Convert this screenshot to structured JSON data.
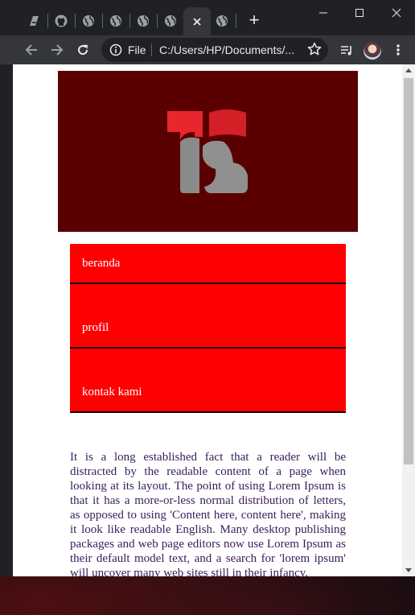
{
  "browser": {
    "tabs": [
      {
        "icon": "app-icon"
      },
      {
        "icon": "github-icon"
      },
      {
        "icon": "globe-icon"
      },
      {
        "icon": "globe-icon"
      },
      {
        "icon": "globe-icon"
      },
      {
        "icon": "globe-icon"
      },
      {
        "icon": "close-icon",
        "active": true
      },
      {
        "icon": "globe-icon"
      }
    ],
    "new_tab_label": "+",
    "address": {
      "scheme_label": "File",
      "url": "C:/Users/HP/Documents/..."
    }
  },
  "page": {
    "menu": [
      "beranda",
      "profil",
      "kontak kami"
    ],
    "body_text": "It is a long established fact that a reader will be distracted by the readable content of a page when looking at its layout. The point of using Lorem Ipsum is that it has a more-or-less normal distribution of letters, as opposed to using 'Content here, content here', making it look like readable English. Many desktop publishing packages and web page editors now use Lorem Ipsum as their default model text, and a search for 'lorem ipsum' will uncover many web sites still in their infancy."
  },
  "colors": {
    "banner": "#5a0000",
    "menu": "#ff0000",
    "text": "#3a1c5a"
  }
}
